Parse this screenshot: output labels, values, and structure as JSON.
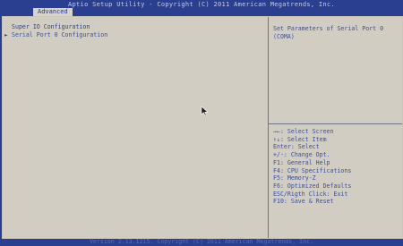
{
  "header": {
    "title": "Aptio Setup Utility - Copyright (C) 2011 American Megatrends, Inc.",
    "tab": "Advanced"
  },
  "menu": {
    "items": [
      {
        "label": "Super IO Configuration"
      },
      {
        "label": "Serial Port 0 Configuration"
      }
    ],
    "arrow": "►"
  },
  "help": {
    "text": "Set Parameters of Serial Port 0 (COMA)"
  },
  "keys": [
    "→←: Select Screen",
    "↑↓: Select Item",
    "Enter: Select",
    "+/-: Change Opt.",
    "F1: General Help",
    "F4: CPU Specifications",
    "F5: Memory-Z",
    "F6: Optimized Defaults",
    "ESC/Rigth Click: Exit",
    "F10: Save & Reset"
  ],
  "footer": {
    "version": "Version 2.13.1215. Copyright (C) 2011 American Megatrends, Inc."
  },
  "colors": {
    "background": "#2a3f8f",
    "panel": "#d1cdc3",
    "text": "#3b4fa4"
  }
}
